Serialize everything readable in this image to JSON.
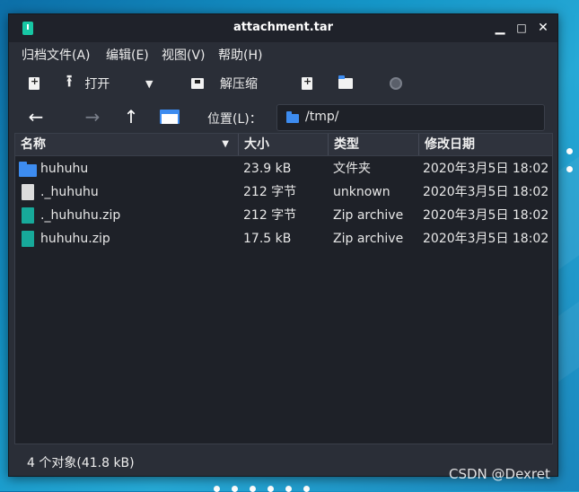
{
  "window": {
    "title": "attachment.tar"
  },
  "menu": [
    "归档文件(A)",
    "编辑(E)",
    "视图(V)",
    "帮助(H)"
  ],
  "toolbar": {
    "open_label": "打开",
    "extract_label": "解压缩"
  },
  "location": {
    "label": "位置(L)：",
    "path": "/tmp/"
  },
  "columns": [
    "名称",
    "大小",
    "类型",
    "修改日期"
  ],
  "files": [
    {
      "name": "huhuhu",
      "size": "23.9 kB",
      "type": "文件夹",
      "modified": "2020年3月5日 18:02",
      "icon": "folder-icon"
    },
    {
      "name": "._huhuhu",
      "size": "212 字节",
      "type": "unknown",
      "modified": "2020年3月5日 18:02",
      "icon": "unknown-file-icon"
    },
    {
      "name": "._huhuhu.zip",
      "size": "212 字节",
      "type": "Zip archive",
      "modified": "2020年3月5日 18:02",
      "icon": "zip-file-icon"
    },
    {
      "name": "huhuhu.zip",
      "size": "17.5 kB",
      "type": "Zip archive",
      "modified": "2020年3月5日 18:02",
      "icon": "zip-file-icon"
    }
  ],
  "status": "4 个对象(41.8 kB)",
  "watermark": "CSDN @Dexret",
  "colors": {
    "folder": "#3d8cf0",
    "zip": "#17a99a",
    "app_accent": "#17c7a4"
  }
}
